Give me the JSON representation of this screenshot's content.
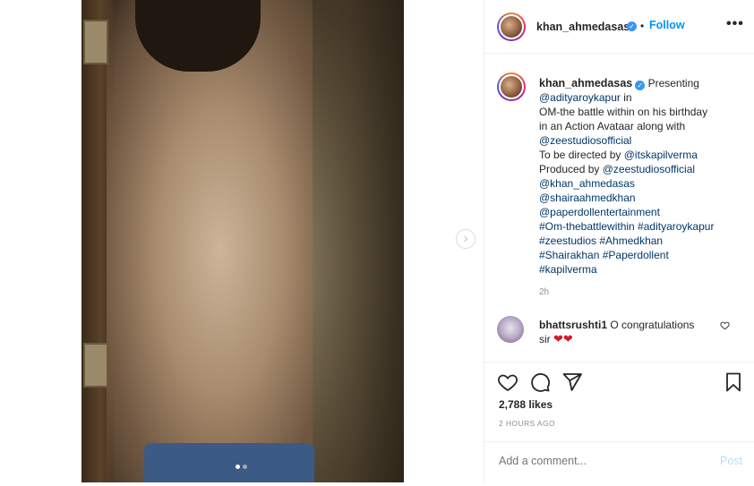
{
  "post": {
    "author": {
      "username": "khan_ahmedasas",
      "verified": true,
      "follow_label": "Follow",
      "separator": "•"
    },
    "more_icon": "more-horizontal-icon",
    "media": {
      "carousel_total": 2,
      "carousel_index": 1,
      "next_icon": "chevron-right-icon"
    },
    "caption": {
      "username": "khan_ahmedasas",
      "lines": [
        {
          "text": "Presenting",
          "tag": false,
          "inline_after_user": true
        },
        {
          "text": "@adityaroykapur in",
          "tag_part": "@adityaroykapur",
          "rest": " in"
        },
        {
          "text": "OM-the battle within on his birthday"
        },
        {
          "text": "in an Action Avataar along with"
        },
        {
          "text": "@zeestudiosofficial",
          "tag_part": "@zeestudiosofficial",
          "rest": ""
        },
        {
          "text": "To be directed by @itskapilverma",
          "pre": "To be directed by ",
          "tag_part": "@itskapilverma"
        },
        {
          "text": "Produced by @zeestudiosofficial",
          "pre": "Produced by ",
          "tag_part": "@zeestudiosofficial"
        },
        {
          "text": "@khan_ahmedasas",
          "tag_part": "@khan_ahmedasas"
        },
        {
          "text": "@shairaahmedkhan",
          "tag_part": "@shairaahmedkhan"
        },
        {
          "text": "@paperdollentertainment",
          "tag_part": "@paperdollentertainment"
        },
        {
          "text": "#Om-thebattlewithin #adityaroykapur",
          "tag_part": "#Om-thebattlewithin #adityaroykapur"
        },
        {
          "text": "#zeestudios #Ahmedkhan",
          "tag_part": "#zeestudios #Ahmedkhan"
        },
        {
          "text": "#Shairakhan #Paperdollent",
          "tag_part": "#Shairakhan #Paperdollent"
        },
        {
          "text": "#kapilverma",
          "tag_part": "#kapilverma"
        }
      ],
      "timestamp": "2h"
    },
    "comments": [
      {
        "username": "bhattsrushti1",
        "text_line1": "O congratulations",
        "text_line2": "sir",
        "emoji": "❤❤"
      }
    ],
    "actions": {
      "like_icon": "heart-icon",
      "comment_icon": "comment-bubble-icon",
      "share_icon": "paper-plane-icon",
      "save_icon": "bookmark-icon"
    },
    "likes": "2,788 likes",
    "time_ago": "2 HOURS AGO",
    "add_comment_placeholder": "Add a comment...",
    "post_label": "Post"
  },
  "colors": {
    "link": "#00376b",
    "follow": "#0095f6",
    "post_disabled": "#b2dffc",
    "muted": "#8e8e8e",
    "verified": "#3897f0"
  }
}
